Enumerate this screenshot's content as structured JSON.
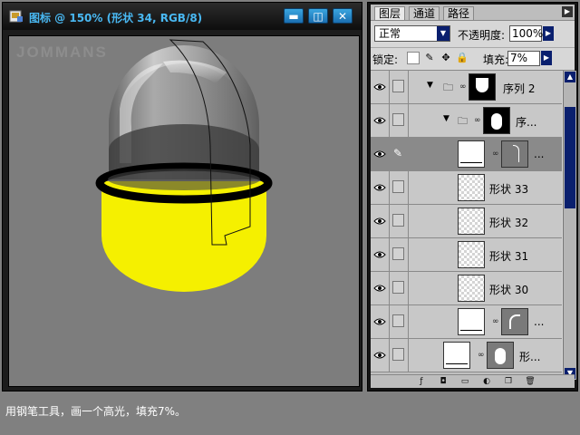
{
  "document": {
    "title": "图标 @ 150% (形状 34, RGB/8)",
    "watermark": "JOMMANS",
    "buttons": {
      "minimize": "▬",
      "restore": "◫",
      "close": "✕"
    }
  },
  "layers_panel": {
    "tabs": [
      {
        "label": "图层"
      },
      {
        "label": "通道"
      },
      {
        "label": "路径"
      }
    ],
    "blend_mode": "正常",
    "opacity_label": "不透明度:",
    "opacity_value": "100%",
    "lock_label": "锁定:",
    "fill_label": "填充:",
    "fill_value": "7%",
    "layers": [
      {
        "name": "序列 2",
        "kind": "group"
      },
      {
        "name": "序...",
        "kind": "group"
      },
      {
        "name": "...",
        "kind": "shape",
        "selected": true
      },
      {
        "name": "形状 33",
        "kind": "shape"
      },
      {
        "name": "形状 32",
        "kind": "shape"
      },
      {
        "name": "形状 31",
        "kind": "shape"
      },
      {
        "name": "形状 30",
        "kind": "shape"
      },
      {
        "name": "...",
        "kind": "shape"
      },
      {
        "name": "形...",
        "kind": "shape"
      }
    ]
  },
  "caption": "用钢笔工具，画一个高光，填充7%。",
  "colors": {
    "accent": "#49b8f2",
    "capsule_yellow": "#f5f000",
    "panel_blue": "#0a1f6e"
  }
}
